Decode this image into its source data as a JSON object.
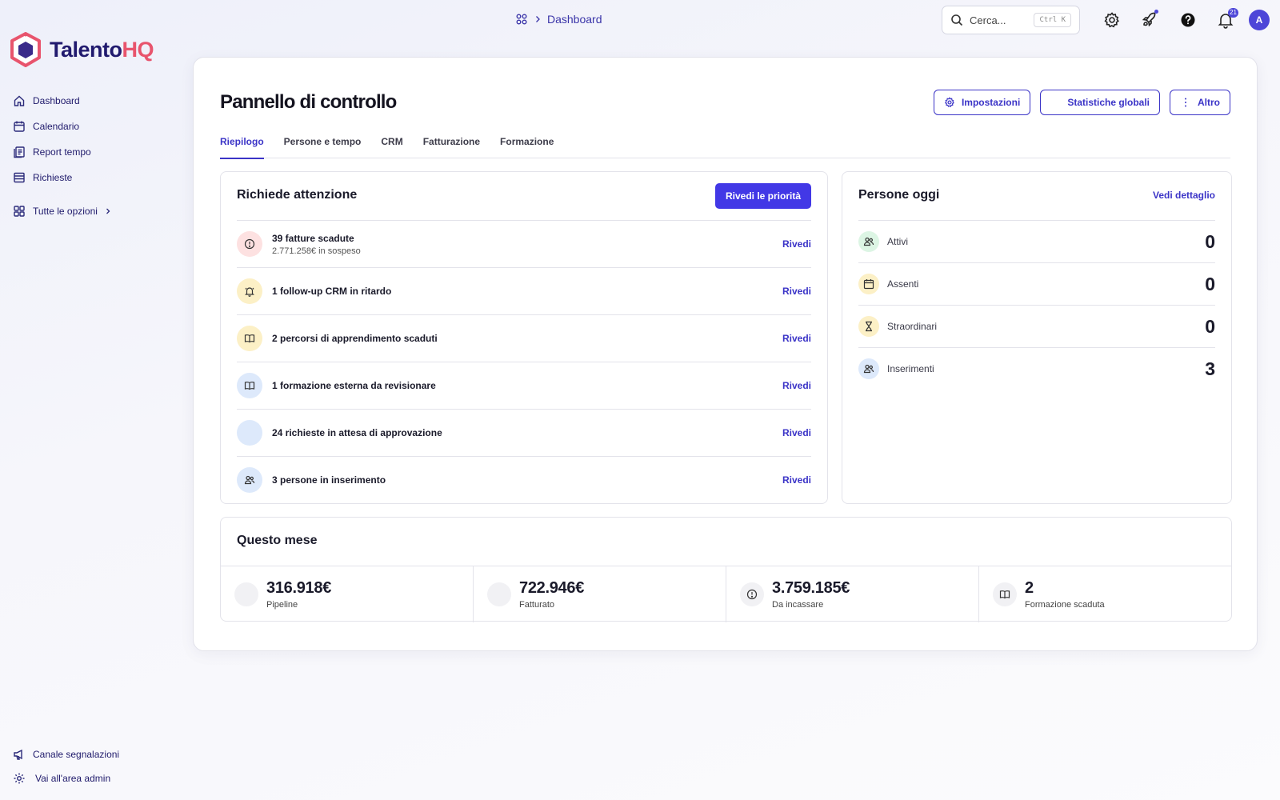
{
  "brand": {
    "name_part1": "Talento",
    "name_part2": "HQ",
    "primary_color": "#4238e6",
    "accent_color": "#e8546d"
  },
  "sidebar": {
    "items": [
      {
        "label": "Dashboard",
        "icon": "home-icon"
      },
      {
        "label": "Calendario",
        "icon": "calendar-icon"
      },
      {
        "label": "Report tempo",
        "icon": "report-icon"
      },
      {
        "label": "Richieste",
        "icon": "list-icon"
      }
    ],
    "all_options": {
      "label": "Tutte le opzioni",
      "icon": "grid-icon"
    },
    "bottom": [
      {
        "label": "Canale segnalazioni",
        "icon": "megaphone-icon"
      },
      {
        "label": "Vai all'area admin",
        "icon": "gear-icon"
      }
    ]
  },
  "topbar": {
    "breadcrumb": "Dashboard",
    "search": {
      "placeholder": "Cerca...",
      "shortcut": "Ctrl K"
    },
    "notifications_count": "21",
    "avatar_initial": "A"
  },
  "page": {
    "title": "Pannello di controllo",
    "actions": {
      "settings": "Impostazioni",
      "stats": "Statistiche globali",
      "more": "Altro"
    },
    "tabs": [
      "Riepilogo",
      "Persone e tempo",
      "CRM",
      "Fatturazione",
      "Formazione"
    ],
    "active_tab": "Riepilogo"
  },
  "attention": {
    "title": "Richiede attenzione",
    "button": "Rivedi le priorità",
    "review_label": "Rivedi",
    "items": [
      {
        "text": "39 fatture scadute",
        "sub": "2.771.258€ in sospeso",
        "icon": "alert-circle-icon",
        "tone": "red"
      },
      {
        "text": "1 follow-up CRM in ritardo",
        "sub": "",
        "icon": "bell-icon",
        "tone": "yellow"
      },
      {
        "text": "2 percorsi di apprendimento scaduti",
        "sub": "",
        "icon": "book-icon",
        "tone": "yellow"
      },
      {
        "text": "1 formazione esterna da revisionare",
        "sub": "",
        "icon": "book-icon",
        "tone": "blue"
      },
      {
        "text": "24 richieste in attesa di approvazione",
        "sub": "",
        "icon": "",
        "tone": "blue"
      },
      {
        "text": "3 persone in inserimento",
        "sub": "",
        "icon": "users-icon",
        "tone": "blue"
      }
    ]
  },
  "people_today": {
    "title": "Persone oggi",
    "link": "Vedi dettaglio",
    "rows": [
      {
        "label": "Attivi",
        "value": "0",
        "icon": "users-icon",
        "tone": "green"
      },
      {
        "label": "Assenti",
        "value": "0",
        "icon": "calendar-icon",
        "tone": "yellow"
      },
      {
        "label": "Straordinari",
        "value": "0",
        "icon": "hourglass-icon",
        "tone": "yellow"
      },
      {
        "label": "Inserimenti",
        "value": "3",
        "icon": "users-icon",
        "tone": "blue"
      }
    ]
  },
  "this_month": {
    "title": "Questo mese",
    "stats": [
      {
        "value": "316.918€",
        "label": "Pipeline",
        "icon": ""
      },
      {
        "value": "722.946€",
        "label": "Fatturato",
        "icon": ""
      },
      {
        "value": "3.759.185€",
        "label": "Da incassare",
        "icon": "alert-circle-icon"
      },
      {
        "value": "2",
        "label": "Formazione scaduta",
        "icon": "book-icon"
      }
    ]
  }
}
